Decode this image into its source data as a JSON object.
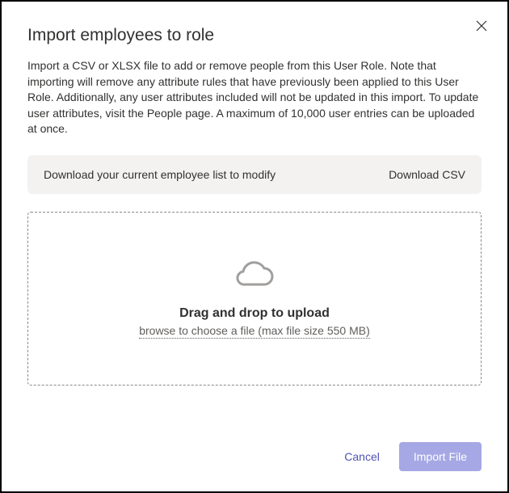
{
  "modal": {
    "title": "Import employees to role",
    "description": "Import a CSV or XLSX file to add or remove people from this User Role. Note that importing will remove any attribute rules that have previously been applied to this User Role. Additionally, any user attributes included will not be updated in this import. To update user attributes, visit the People page. A maximum of 10,000 user entries can be uploaded at once."
  },
  "download": {
    "label": "Download your current employee list to modify",
    "link": "Download CSV"
  },
  "dropzone": {
    "title": "Drag and drop to upload",
    "browse": "browse to choose a file (max file size 550 MB)"
  },
  "footer": {
    "cancel": "Cancel",
    "import": "Import File"
  }
}
